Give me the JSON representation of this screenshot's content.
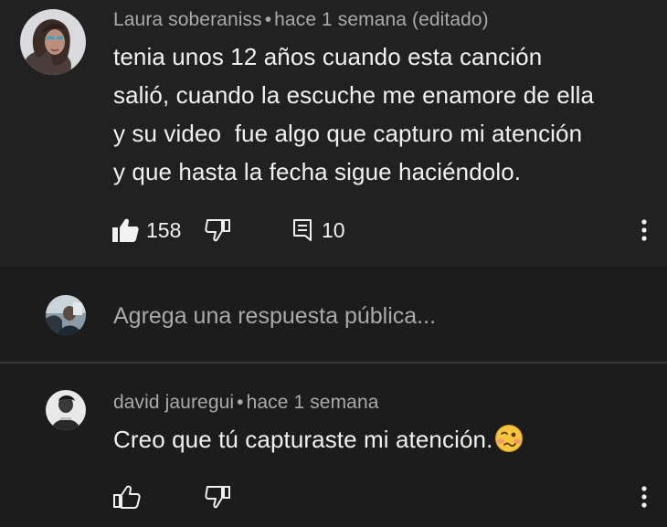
{
  "comment": {
    "author": "Laura soberaniss",
    "separator": "•",
    "timestamp": "hace 1 semana (editado)",
    "text_lines": [
      "tenia unos 12 años cuando esta canción",
      "salió, cuando la escuche me enamore de ella",
      "y su video  fue algo que capturo mi atención",
      "y que hasta la fecha sigue haciéndolo."
    ],
    "likes": "158",
    "replies": "10",
    "icons": {
      "like": "thumb-up-filled-icon",
      "dislike": "thumb-down-icon",
      "replies": "comment-icon",
      "more": "more-vert-icon"
    }
  },
  "reply_box": {
    "placeholder": "Agrega una respuesta pública..."
  },
  "reply": {
    "author": "david jauregui",
    "separator": "•",
    "timestamp": "hace 1 semana",
    "text": "Creo que tú capturaste mi atención.",
    "emoji": "woozy-face-emoji",
    "icons": {
      "like": "thumb-up-outline-icon",
      "dislike": "thumb-down-icon",
      "more": "more-vert-icon"
    }
  },
  "colors": {
    "background": "#212121",
    "background_reply": "#1c1c1c",
    "text_primary": "#f1f1f1",
    "text_secondary": "#aaaaaa"
  }
}
